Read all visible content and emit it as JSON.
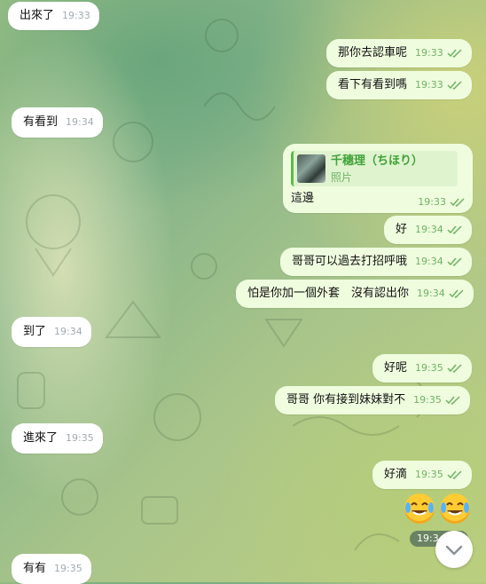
{
  "messages": [
    {
      "text": "出來了",
      "time": "19:33"
    },
    {
      "text": "那你去認車呢",
      "time": "19:33"
    },
    {
      "text": "看下有看到嗎",
      "time": "19:33"
    },
    {
      "text": "有看到",
      "time": "19:34"
    },
    {
      "reply_name": "千穗理（ちほり）",
      "reply_sub": "照片",
      "text": "這邊",
      "time": "19:33"
    },
    {
      "text": "好",
      "time": "19:34"
    },
    {
      "text": "哥哥可以過去打招呼哦",
      "time": "19:34"
    },
    {
      "text": "怕是你加一個外套　沒有認出你",
      "time": "19:34"
    },
    {
      "text": "到了",
      "time": "19:34"
    },
    {
      "text": "好呢",
      "time": "19:35"
    },
    {
      "text": "哥哥 你有接到妹妹對不",
      "time": "19:35"
    },
    {
      "text": "進來了",
      "time": "19:35"
    },
    {
      "text": "好滴",
      "time": "19:35"
    },
    {
      "text": "有有",
      "time": "19:35"
    }
  ],
  "emoji_time": "19:3",
  "icons": {
    "read_receipt": "double-check-icon",
    "scroll_down": "chevron-down-icon",
    "emoji": "tears-of-joy-emoji-icon"
  },
  "colors": {
    "outgoing_bubble": "#effdde",
    "incoming_bubble": "#ffffff",
    "accent_green": "#5fb94d",
    "check_green": "#6fb265"
  }
}
